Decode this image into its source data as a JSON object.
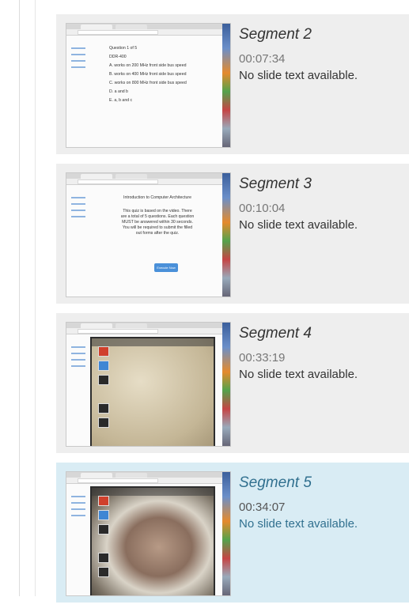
{
  "segments": [
    {
      "title": "Segment 2",
      "time": "00:07:34",
      "description": "No slide text available.",
      "active": false,
      "thumbnail": {
        "kind": "quiz-question",
        "lines": [
          "Question 1 of 5",
          "DDR-400",
          "A. works on 200 MHz front side bus speed",
          "B. works on 400 MHz front side bus speed",
          "C. works on 800 MHz front side bus speed",
          "D. a and b",
          "E. a, b and c"
        ]
      }
    },
    {
      "title": "Segment 3",
      "time": "00:10:04",
      "description": "No slide text available.",
      "active": false,
      "thumbnail": {
        "kind": "quiz-intro",
        "lines": [
          "Introduction to Computer Architecture",
          "This quiz is based on the video. There are a total of 5 questions. Each question MUST be answered within 30 seconds. You will be required to submit the filled out forms after the quiz."
        ],
        "button": "Execute Now"
      }
    },
    {
      "title": "Segment 4",
      "time": "00:33:19",
      "description": "No slide text available.",
      "active": false,
      "thumbnail": {
        "kind": "camera-view"
      }
    },
    {
      "title": "Segment 5",
      "time": "00:34:07",
      "description": "No slide text available.",
      "active": true,
      "thumbnail": {
        "kind": "camera-view-hand"
      }
    }
  ],
  "colors": {
    "segment_bg": "#eeeeee",
    "active_bg": "#d9ecf4",
    "active_text": "#31708f",
    "time_text": "#777777"
  }
}
